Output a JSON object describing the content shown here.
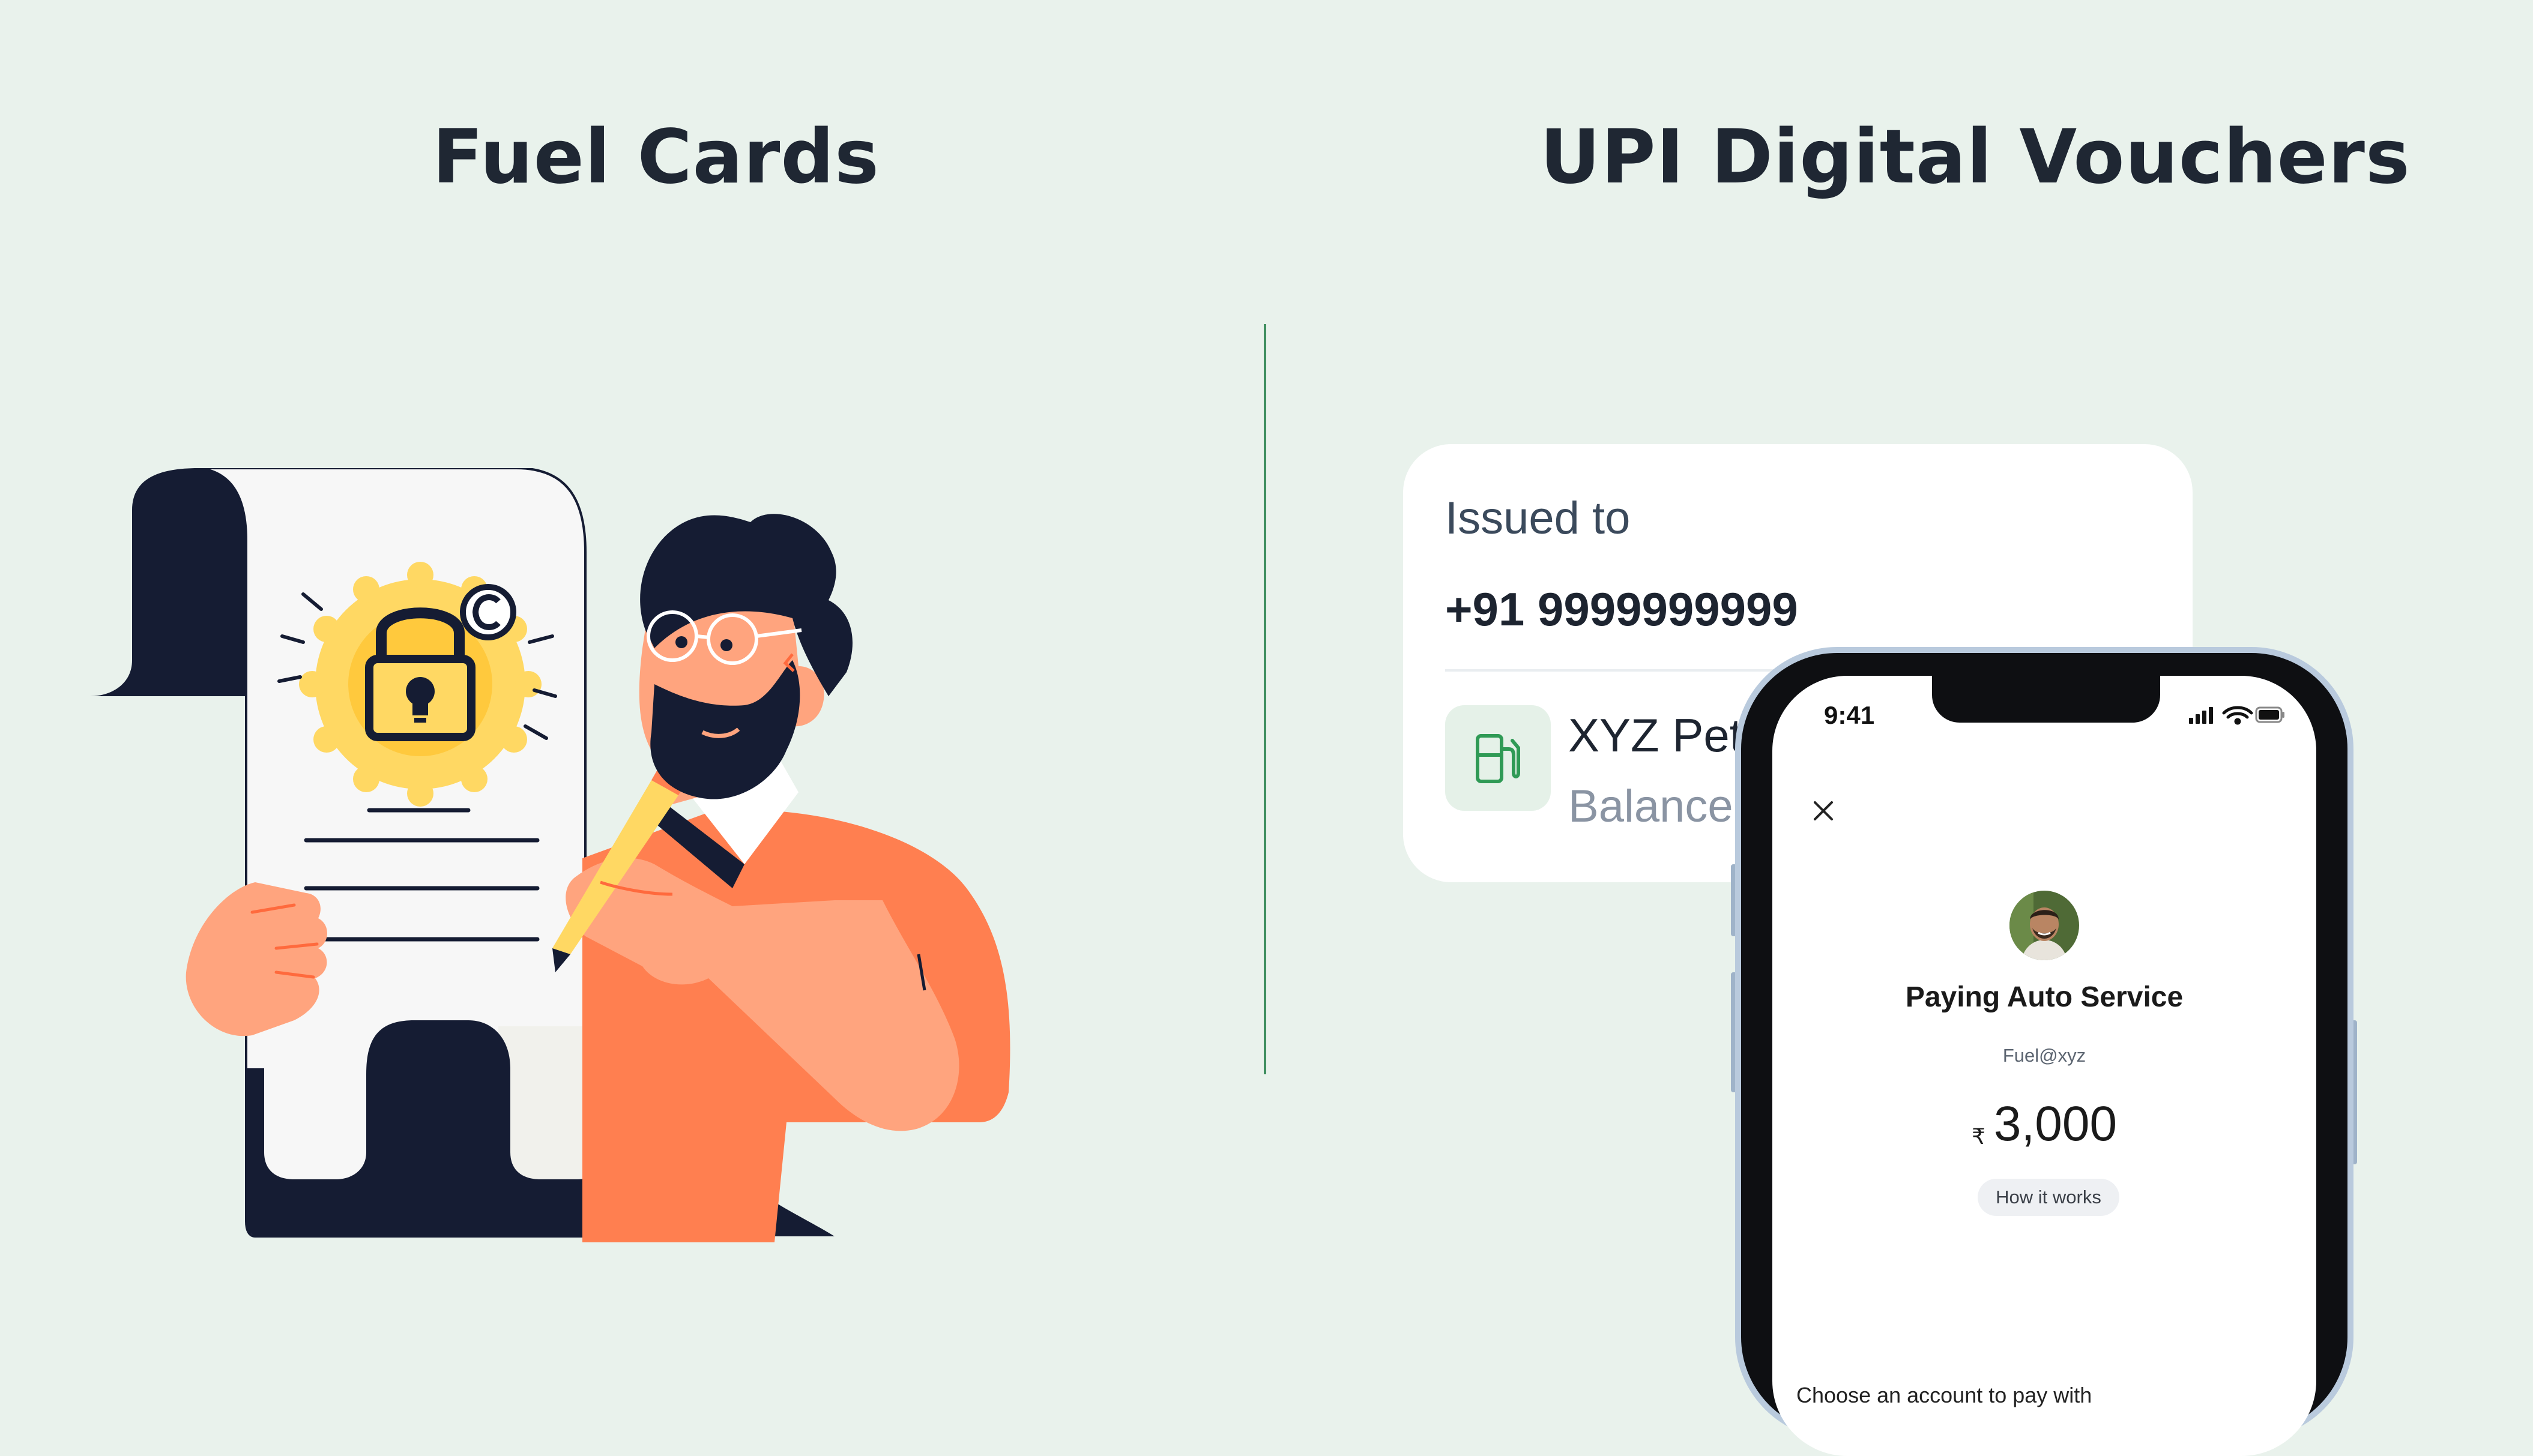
{
  "left_heading": "Fuel Cards",
  "right_heading": "UPI Digital Vouchers",
  "voucher_card": {
    "issued_label": "Issued to",
    "phone_number": "+91 9999999999",
    "vendor_name_visible": "XYZ Petro",
    "balance_visible": "Balance:",
    "icon": "fuel-pump-icon"
  },
  "phone": {
    "status_time": "9:41",
    "status_icons": [
      "signal-icon",
      "wifi-icon",
      "battery-icon"
    ],
    "close_icon": "close-icon",
    "title": "Paying Auto Service",
    "upi_id": "Fuel@xyz",
    "currency": "₹",
    "amount": "3,000",
    "how_it_works": "How it works",
    "choose_account": "Choose an account to pay with"
  },
  "colors": {
    "background": "#e9f2ec",
    "divider": "#3f8f5f",
    "heading": "#1f2733",
    "navy": "#151c33",
    "orange": "#ff7f50",
    "skin": "#ffa47e",
    "gold": "#ffd863"
  }
}
